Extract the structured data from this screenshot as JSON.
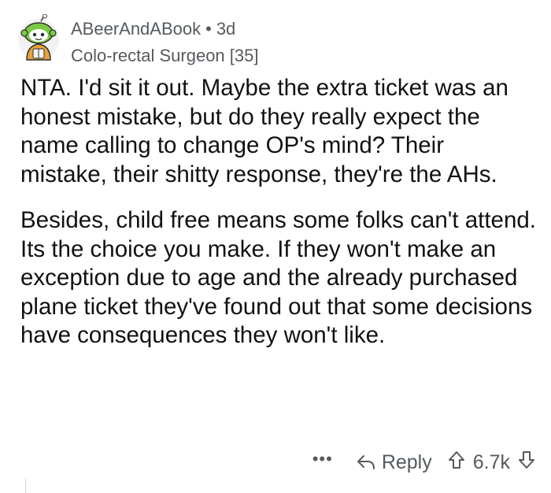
{
  "comment": {
    "author": "ABeerAndABook",
    "separator": "•",
    "age": "3d",
    "flair": "Colo-rectal Surgeon [35]",
    "paragraphs": [
      "NTA. I'd sit it out.  Maybe the extra ticket was an honest mistake, but do they really expect the name calling to change OP's mind?  Their mistake, their shitty response, they're the AHs.",
      "Besides, child free means some folks can't attend.  Its the choice you make.  If they won't make an exception due to age and the already purchased plane ticket they've found out that some decisions have consequences they won't like."
    ]
  },
  "actions": {
    "more": "•••",
    "reply_label": "Reply",
    "score": "6.7k"
  },
  "icons": {
    "avatar": "snoo-avatar-icon",
    "reply": "reply-arrow-icon",
    "upvote": "upvote-arrow-icon",
    "downvote": "downvote-arrow-icon"
  },
  "colors": {
    "meta_text": "#555a5e",
    "body_text": "#111111",
    "avatar_green": "#7ac943"
  }
}
